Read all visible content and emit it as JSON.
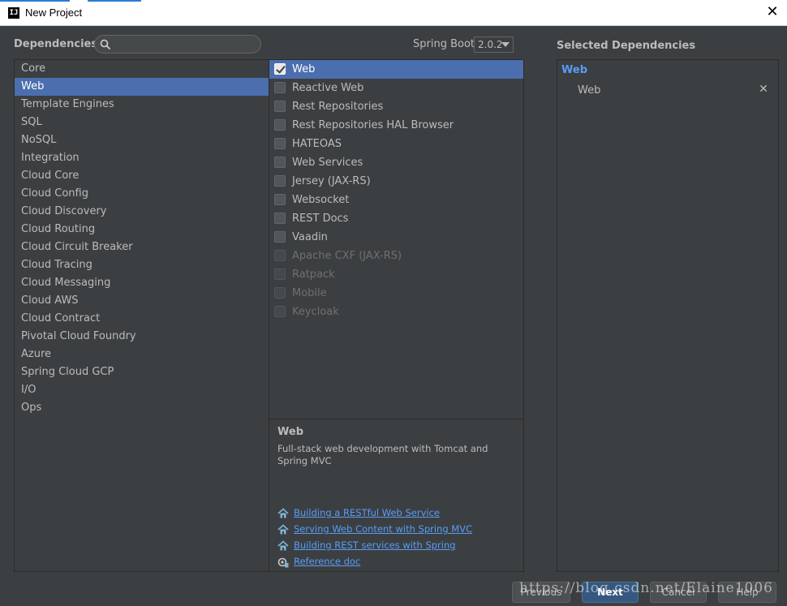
{
  "window": {
    "title": "New Project",
    "close_icon": "close-icon"
  },
  "header": {
    "dependencies_label": "Dependencies",
    "search": {
      "value": "",
      "placeholder": ""
    },
    "spring_boot_label": "Spring Boot",
    "spring_boot_version": "2.0.2"
  },
  "categories": [
    "Core",
    "Web",
    "Template Engines",
    "SQL",
    "NoSQL",
    "Integration",
    "Cloud Core",
    "Cloud Config",
    "Cloud Discovery",
    "Cloud Routing",
    "Cloud Circuit Breaker",
    "Cloud Tracing",
    "Cloud Messaging",
    "Cloud AWS",
    "Cloud Contract",
    "Pivotal Cloud Foundry",
    "Azure",
    "Spring Cloud GCP",
    "I/O",
    "Ops"
  ],
  "selected_category": "Web",
  "dependencies": [
    {
      "label": "Web",
      "checked": true,
      "enabled": true,
      "selected": true
    },
    {
      "label": "Reactive Web",
      "checked": false,
      "enabled": true,
      "selected": false
    },
    {
      "label": "Rest Repositories",
      "checked": false,
      "enabled": true,
      "selected": false
    },
    {
      "label": "Rest Repositories HAL Browser",
      "checked": false,
      "enabled": true,
      "selected": false
    },
    {
      "label": "HATEOAS",
      "checked": false,
      "enabled": true,
      "selected": false
    },
    {
      "label": "Web Services",
      "checked": false,
      "enabled": true,
      "selected": false
    },
    {
      "label": "Jersey (JAX-RS)",
      "checked": false,
      "enabled": true,
      "selected": false
    },
    {
      "label": "Websocket",
      "checked": false,
      "enabled": true,
      "selected": false
    },
    {
      "label": "REST Docs",
      "checked": false,
      "enabled": true,
      "selected": false
    },
    {
      "label": "Vaadin",
      "checked": false,
      "enabled": true,
      "selected": false
    },
    {
      "label": "Apache CXF (JAX-RS)",
      "checked": false,
      "enabled": false,
      "selected": false
    },
    {
      "label": "Ratpack",
      "checked": false,
      "enabled": false,
      "selected": false
    },
    {
      "label": "Mobile",
      "checked": false,
      "enabled": false,
      "selected": false
    },
    {
      "label": "Keycloak",
      "checked": false,
      "enabled": false,
      "selected": false
    }
  ],
  "description": {
    "title": "Web",
    "text": "Full-stack web development with Tomcat and Spring MVC",
    "links": [
      {
        "label": "Building a RESTful Web Service",
        "icon": "home-icon"
      },
      {
        "label": "Serving Web Content with Spring MVC",
        "icon": "home-icon"
      },
      {
        "label": "Building REST services with Spring",
        "icon": "home-icon"
      },
      {
        "label": "Reference doc",
        "icon": "gear-doc-icon"
      }
    ]
  },
  "selected_dependencies": {
    "label": "Selected Dependencies",
    "group": "Web",
    "items": [
      "Web"
    ],
    "remove_icon": "close-icon"
  },
  "buttons": {
    "previous": "Previous",
    "next": "Next",
    "cancel": "Cancel",
    "help": "Help"
  },
  "watermark": "https://blog.csdn.net/Elaine1006",
  "colors": {
    "accent": "#4b6eaf",
    "link": "#589df6",
    "background": "#3c3f41"
  }
}
